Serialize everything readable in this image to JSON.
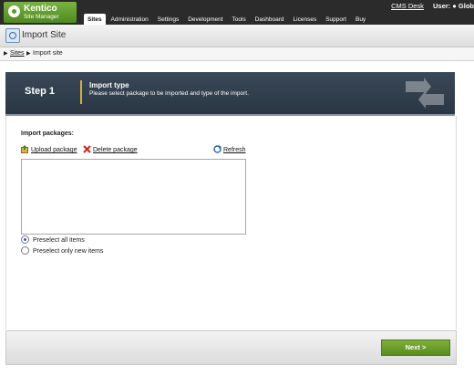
{
  "app": {
    "logo_name": "Kentico",
    "logo_sub": "Site Manager",
    "cms_desk_link": "CMS Desk",
    "user_label": "User:",
    "user_name": "Glob"
  },
  "nav": {
    "items": [
      "Sites",
      "Administration",
      "Settings",
      "Development",
      "Tools",
      "Dashboard",
      "Licenses",
      "Support",
      "Buy"
    ],
    "active": "Sites"
  },
  "page": {
    "title": "Import Site"
  },
  "breadcrumb": {
    "link": "Sites",
    "current": "Import site"
  },
  "wizard": {
    "step": "Step 1",
    "step_title": "Import type",
    "step_desc": "Please select package to be imported and type of the import."
  },
  "content": {
    "packages_label": "Import packages:",
    "upload_label": "Upload package",
    "delete_label": "Delete package",
    "refresh_label": "Refresh",
    "radio_all": "Preselect all items",
    "radio_new": "Preselect only new items",
    "selected_radio": "Preselect all items"
  },
  "footer": {
    "next_label": "Next >"
  },
  "colors": {
    "topbar": "#2b2b2b",
    "brand_green": "#5b9a26",
    "wizard_header": "#2f3c4a",
    "accent_gold": "#d7b13b",
    "next_button": "#6b9c28"
  }
}
